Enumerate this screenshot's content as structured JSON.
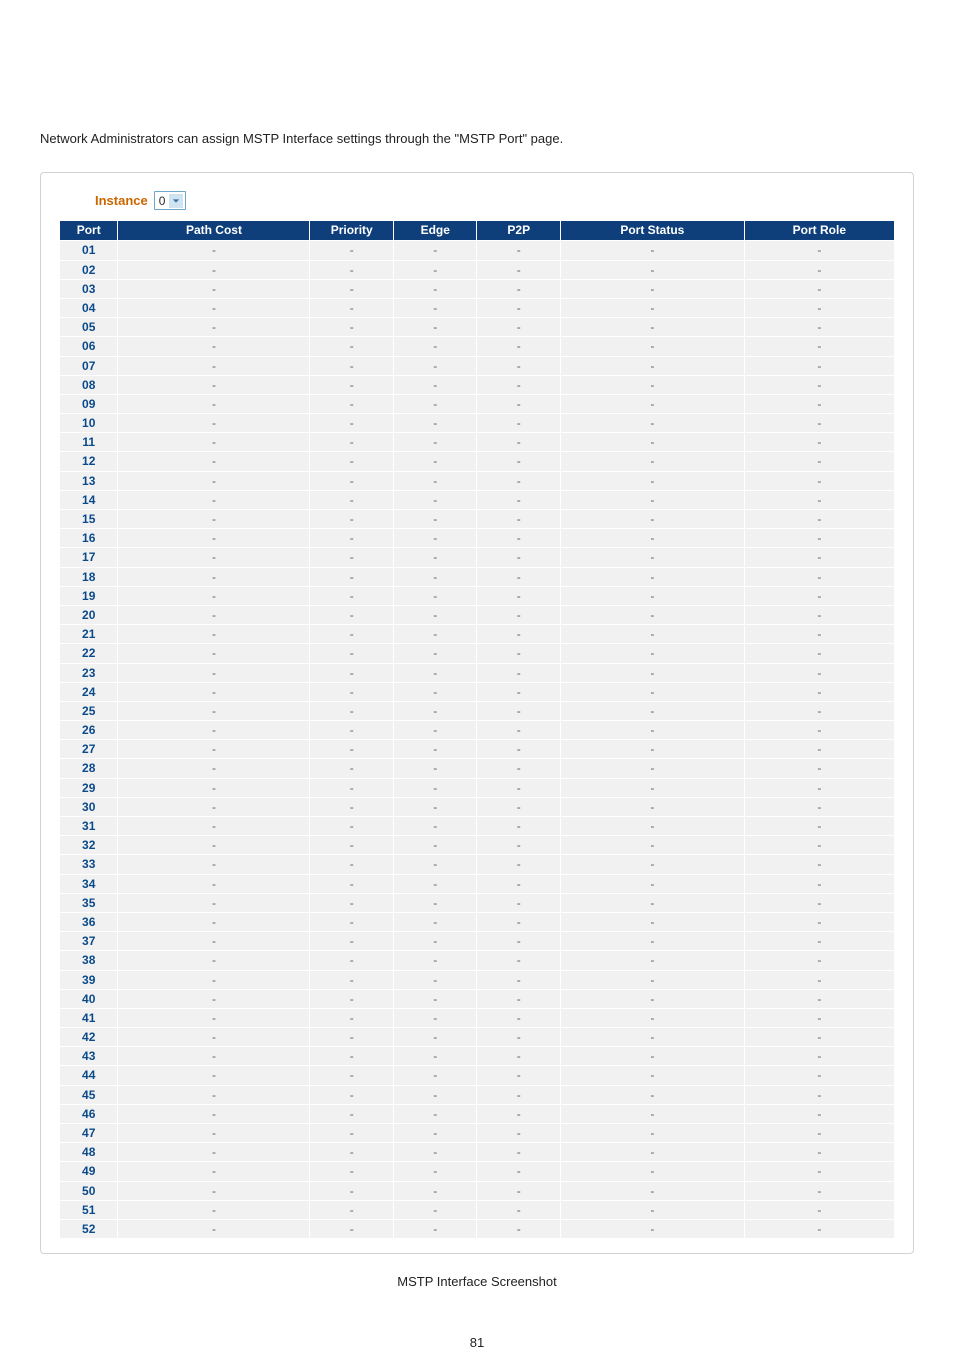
{
  "intro_text": "Network Administrators can assign MSTP Interface settings through the \"MSTP Port\" page.",
  "instance": {
    "label": "Instance",
    "value": "0"
  },
  "table": {
    "headers": {
      "port": "Port",
      "path_cost": "Path Cost",
      "priority": "Priority",
      "edge": "Edge",
      "p2p": "P2P",
      "port_status": "Port Status",
      "port_role": "Port Role"
    },
    "rows": [
      {
        "port": "01",
        "path_cost": "-",
        "priority": "-",
        "edge": "-",
        "p2p": "-",
        "port_status": "-",
        "port_role": "-"
      },
      {
        "port": "02",
        "path_cost": "-",
        "priority": "-",
        "edge": "-",
        "p2p": "-",
        "port_status": "-",
        "port_role": "-"
      },
      {
        "port": "03",
        "path_cost": "-",
        "priority": "-",
        "edge": "-",
        "p2p": "-",
        "port_status": "-",
        "port_role": "-"
      },
      {
        "port": "04",
        "path_cost": "-",
        "priority": "-",
        "edge": "-",
        "p2p": "-",
        "port_status": "-",
        "port_role": "-"
      },
      {
        "port": "05",
        "path_cost": "-",
        "priority": "-",
        "edge": "-",
        "p2p": "-",
        "port_status": "-",
        "port_role": "-"
      },
      {
        "port": "06",
        "path_cost": "-",
        "priority": "-",
        "edge": "-",
        "p2p": "-",
        "port_status": "-",
        "port_role": "-"
      },
      {
        "port": "07",
        "path_cost": "-",
        "priority": "-",
        "edge": "-",
        "p2p": "-",
        "port_status": "-",
        "port_role": "-"
      },
      {
        "port": "08",
        "path_cost": "-",
        "priority": "-",
        "edge": "-",
        "p2p": "-",
        "port_status": "-",
        "port_role": "-"
      },
      {
        "port": "09",
        "path_cost": "-",
        "priority": "-",
        "edge": "-",
        "p2p": "-",
        "port_status": "-",
        "port_role": "-"
      },
      {
        "port": "10",
        "path_cost": "-",
        "priority": "-",
        "edge": "-",
        "p2p": "-",
        "port_status": "-",
        "port_role": "-"
      },
      {
        "port": "11",
        "path_cost": "-",
        "priority": "-",
        "edge": "-",
        "p2p": "-",
        "port_status": "-",
        "port_role": "-"
      },
      {
        "port": "12",
        "path_cost": "-",
        "priority": "-",
        "edge": "-",
        "p2p": "-",
        "port_status": "-",
        "port_role": "-"
      },
      {
        "port": "13",
        "path_cost": "-",
        "priority": "-",
        "edge": "-",
        "p2p": "-",
        "port_status": "-",
        "port_role": "-"
      },
      {
        "port": "14",
        "path_cost": "-",
        "priority": "-",
        "edge": "-",
        "p2p": "-",
        "port_status": "-",
        "port_role": "-"
      },
      {
        "port": "15",
        "path_cost": "-",
        "priority": "-",
        "edge": "-",
        "p2p": "-",
        "port_status": "-",
        "port_role": "-"
      },
      {
        "port": "16",
        "path_cost": "-",
        "priority": "-",
        "edge": "-",
        "p2p": "-",
        "port_status": "-",
        "port_role": "-"
      },
      {
        "port": "17",
        "path_cost": "-",
        "priority": "-",
        "edge": "-",
        "p2p": "-",
        "port_status": "-",
        "port_role": "-"
      },
      {
        "port": "18",
        "path_cost": "-",
        "priority": "-",
        "edge": "-",
        "p2p": "-",
        "port_status": "-",
        "port_role": "-"
      },
      {
        "port": "19",
        "path_cost": "-",
        "priority": "-",
        "edge": "-",
        "p2p": "-",
        "port_status": "-",
        "port_role": "-"
      },
      {
        "port": "20",
        "path_cost": "-",
        "priority": "-",
        "edge": "-",
        "p2p": "-",
        "port_status": "-",
        "port_role": "-"
      },
      {
        "port": "21",
        "path_cost": "-",
        "priority": "-",
        "edge": "-",
        "p2p": "-",
        "port_status": "-",
        "port_role": "-"
      },
      {
        "port": "22",
        "path_cost": "-",
        "priority": "-",
        "edge": "-",
        "p2p": "-",
        "port_status": "-",
        "port_role": "-"
      },
      {
        "port": "23",
        "path_cost": "-",
        "priority": "-",
        "edge": "-",
        "p2p": "-",
        "port_status": "-",
        "port_role": "-"
      },
      {
        "port": "24",
        "path_cost": "-",
        "priority": "-",
        "edge": "-",
        "p2p": "-",
        "port_status": "-",
        "port_role": "-"
      },
      {
        "port": "25",
        "path_cost": "-",
        "priority": "-",
        "edge": "-",
        "p2p": "-",
        "port_status": "-",
        "port_role": "-"
      },
      {
        "port": "26",
        "path_cost": "-",
        "priority": "-",
        "edge": "-",
        "p2p": "-",
        "port_status": "-",
        "port_role": "-"
      },
      {
        "port": "27",
        "path_cost": "-",
        "priority": "-",
        "edge": "-",
        "p2p": "-",
        "port_status": "-",
        "port_role": "-"
      },
      {
        "port": "28",
        "path_cost": "-",
        "priority": "-",
        "edge": "-",
        "p2p": "-",
        "port_status": "-",
        "port_role": "-"
      },
      {
        "port": "29",
        "path_cost": "-",
        "priority": "-",
        "edge": "-",
        "p2p": "-",
        "port_status": "-",
        "port_role": "-"
      },
      {
        "port": "30",
        "path_cost": "-",
        "priority": "-",
        "edge": "-",
        "p2p": "-",
        "port_status": "-",
        "port_role": "-"
      },
      {
        "port": "31",
        "path_cost": "-",
        "priority": "-",
        "edge": "-",
        "p2p": "-",
        "port_status": "-",
        "port_role": "-"
      },
      {
        "port": "32",
        "path_cost": "-",
        "priority": "-",
        "edge": "-",
        "p2p": "-",
        "port_status": "-",
        "port_role": "-"
      },
      {
        "port": "33",
        "path_cost": "-",
        "priority": "-",
        "edge": "-",
        "p2p": "-",
        "port_status": "-",
        "port_role": "-"
      },
      {
        "port": "34",
        "path_cost": "-",
        "priority": "-",
        "edge": "-",
        "p2p": "-",
        "port_status": "-",
        "port_role": "-"
      },
      {
        "port": "35",
        "path_cost": "-",
        "priority": "-",
        "edge": "-",
        "p2p": "-",
        "port_status": "-",
        "port_role": "-"
      },
      {
        "port": "36",
        "path_cost": "-",
        "priority": "-",
        "edge": "-",
        "p2p": "-",
        "port_status": "-",
        "port_role": "-"
      },
      {
        "port": "37",
        "path_cost": "-",
        "priority": "-",
        "edge": "-",
        "p2p": "-",
        "port_status": "-",
        "port_role": "-"
      },
      {
        "port": "38",
        "path_cost": "-",
        "priority": "-",
        "edge": "-",
        "p2p": "-",
        "port_status": "-",
        "port_role": "-"
      },
      {
        "port": "39",
        "path_cost": "-",
        "priority": "-",
        "edge": "-",
        "p2p": "-",
        "port_status": "-",
        "port_role": "-"
      },
      {
        "port": "40",
        "path_cost": "-",
        "priority": "-",
        "edge": "-",
        "p2p": "-",
        "port_status": "-",
        "port_role": "-"
      },
      {
        "port": "41",
        "path_cost": "-",
        "priority": "-",
        "edge": "-",
        "p2p": "-",
        "port_status": "-",
        "port_role": "-"
      },
      {
        "port": "42",
        "path_cost": "-",
        "priority": "-",
        "edge": "-",
        "p2p": "-",
        "port_status": "-",
        "port_role": "-"
      },
      {
        "port": "43",
        "path_cost": "-",
        "priority": "-",
        "edge": "-",
        "p2p": "-",
        "port_status": "-",
        "port_role": "-"
      },
      {
        "port": "44",
        "path_cost": "-",
        "priority": "-",
        "edge": "-",
        "p2p": "-",
        "port_status": "-",
        "port_role": "-"
      },
      {
        "port": "45",
        "path_cost": "-",
        "priority": "-",
        "edge": "-",
        "p2p": "-",
        "port_status": "-",
        "port_role": "-"
      },
      {
        "port": "46",
        "path_cost": "-",
        "priority": "-",
        "edge": "-",
        "p2p": "-",
        "port_status": "-",
        "port_role": "-"
      },
      {
        "port": "47",
        "path_cost": "-",
        "priority": "-",
        "edge": "-",
        "p2p": "-",
        "port_status": "-",
        "port_role": "-"
      },
      {
        "port": "48",
        "path_cost": "-",
        "priority": "-",
        "edge": "-",
        "p2p": "-",
        "port_status": "-",
        "port_role": "-"
      },
      {
        "port": "49",
        "path_cost": "-",
        "priority": "-",
        "edge": "-",
        "p2p": "-",
        "port_status": "-",
        "port_role": "-"
      },
      {
        "port": "50",
        "path_cost": "-",
        "priority": "-",
        "edge": "-",
        "p2p": "-",
        "port_status": "-",
        "port_role": "-"
      },
      {
        "port": "51",
        "path_cost": "-",
        "priority": "-",
        "edge": "-",
        "p2p": "-",
        "port_status": "-",
        "port_role": "-"
      },
      {
        "port": "52",
        "path_cost": "-",
        "priority": "-",
        "edge": "-",
        "p2p": "-",
        "port_status": "-",
        "port_role": "-"
      }
    ]
  },
  "caption": "MSTP Interface Screenshot",
  "page_number": "81"
}
